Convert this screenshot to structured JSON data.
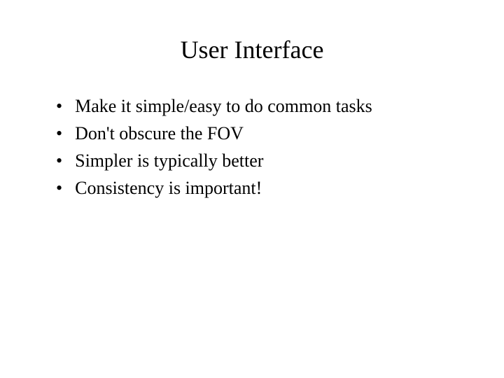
{
  "slide": {
    "title": "User Interface",
    "bullets": [
      "Make it simple/easy to do common tasks",
      "Don't obscure the FOV",
      "Simpler is typically better",
      "Consistency is important!"
    ]
  }
}
